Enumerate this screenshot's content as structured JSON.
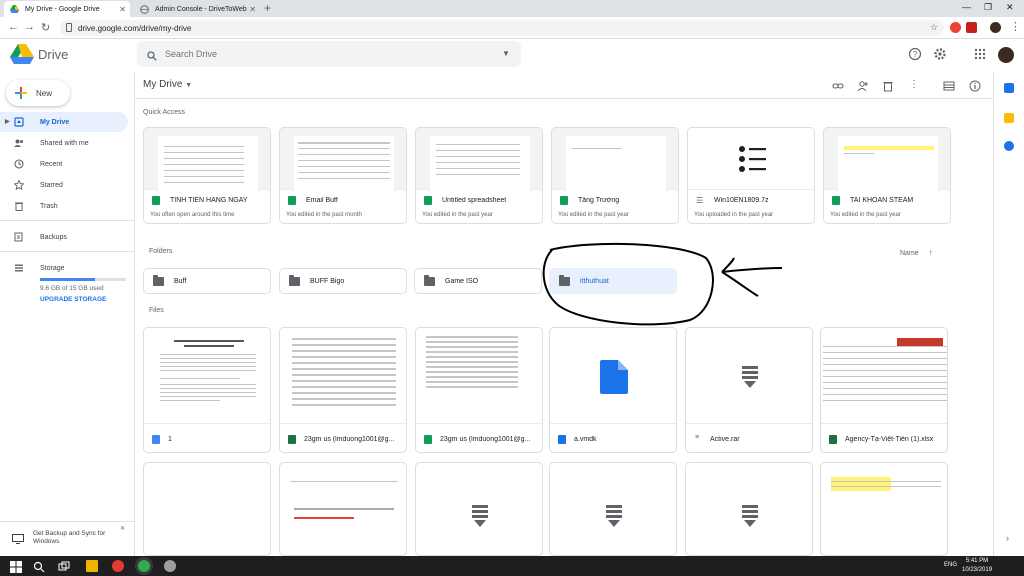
{
  "browser": {
    "tabs": [
      {
        "label": "My Drive - Google Drive",
        "active": true
      },
      {
        "label": "Admin Console - DriveToWeb",
        "active": false
      }
    ],
    "url": "drive.google.com/drive/my-drive"
  },
  "header": {
    "brand": "Drive",
    "search_placeholder": "Search Drive"
  },
  "sidebar": {
    "new_label": "New",
    "items": [
      {
        "label": "My Drive",
        "icon": "my-drive-icon",
        "active": true
      },
      {
        "label": "Shared with me",
        "icon": "shared-icon",
        "active": false
      },
      {
        "label": "Recent",
        "icon": "clock-icon",
        "active": false
      },
      {
        "label": "Starred",
        "icon": "star-icon",
        "active": false
      },
      {
        "label": "Trash",
        "icon": "trash-icon",
        "active": false
      },
      {
        "label": "Backups",
        "icon": "backup-icon",
        "active": false
      },
      {
        "label": "Storage",
        "icon": "storage-icon",
        "active": false
      }
    ],
    "storage_used": "9.6 GB of 15 GB used",
    "storage_fraction": 0.64,
    "upgrade_label": "UPGRADE STORAGE",
    "backup_promo": "Get Backup and Sync for Windows"
  },
  "main": {
    "title": "My Drive",
    "quick_access_label": "Quick Access",
    "quick_access": [
      {
        "name": "TINH TIEN HANG NGAY",
        "sub": "You often open around this time",
        "type": "sheet"
      },
      {
        "name": "Email Buff",
        "sub": "You edited in the past month",
        "type": "sheet"
      },
      {
        "name": "Untitled spreadsheet",
        "sub": "You edited in the past year",
        "type": "sheet"
      },
      {
        "name": "Tăng Trưởng",
        "sub": "You edited in the past year",
        "type": "sheet"
      },
      {
        "name": "Win10EN1809.7z",
        "sub": "You uploaded in the past year",
        "type": "archive"
      },
      {
        "name": "TAI KHOAN STEAM",
        "sub": "You edited in the past year",
        "type": "sheet"
      }
    ],
    "folders_label": "Folders",
    "sort_label": "Name",
    "folders": [
      {
        "name": "Buff",
        "selected": false
      },
      {
        "name": "BUFF Bigo",
        "selected": false
      },
      {
        "name": "Game ISO",
        "selected": false
      },
      {
        "name": "itthuthuat",
        "selected": true
      }
    ],
    "files_label": "Files",
    "files": [
      {
        "name": "1",
        "type": "doc"
      },
      {
        "name": "23gm us (lmduong1001@g...",
        "type": "excel"
      },
      {
        "name": "23gm us (lmduong1001@g...",
        "type": "sheet"
      },
      {
        "name": "a.vmdk",
        "type": "file"
      },
      {
        "name": "Active.rar",
        "type": "archive"
      },
      {
        "name": "Agency-Tạ-Việt-Tiến (1).xlsx",
        "type": "excel"
      }
    ]
  },
  "taskbar": {
    "lang": "ENG",
    "time": "5:41 PM",
    "date": "10/23/2019"
  },
  "colors": {
    "accent": "#1a73e8",
    "selected_bg": "#e8f0fe",
    "sheet_green": "#0f9d58",
    "doc_blue": "#4285f4",
    "excel_green": "#1e7145"
  }
}
